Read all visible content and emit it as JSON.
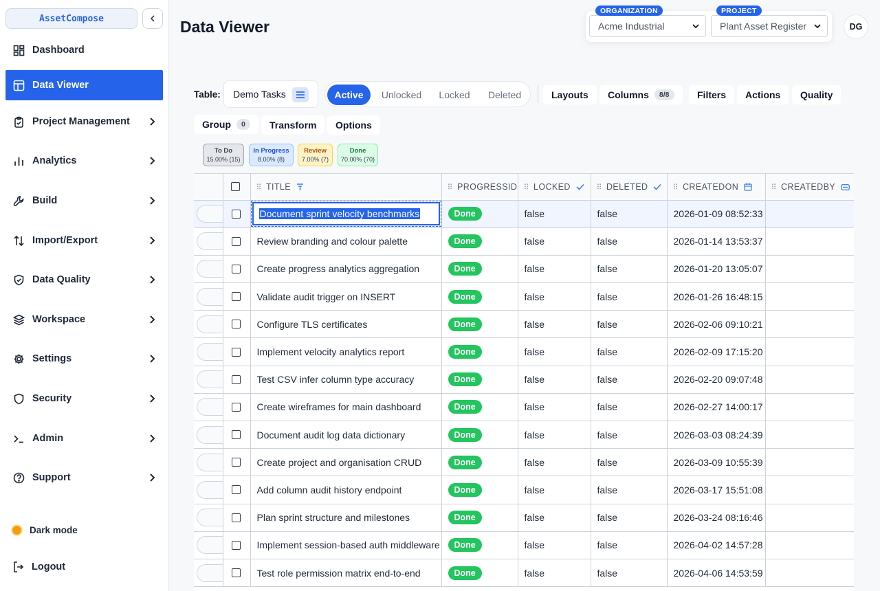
{
  "sidebar": {
    "brand": "AssetCompose",
    "items": [
      {
        "label": "Dashboard",
        "icon": "dashboard-icon"
      },
      {
        "label": "Data Viewer",
        "icon": "table-icon",
        "active": true
      },
      {
        "label": "Project Management",
        "icon": "clipboard-icon"
      },
      {
        "label": "Analytics",
        "icon": "bar-chart-icon"
      },
      {
        "label": "Build",
        "icon": "wrench-icon"
      },
      {
        "label": "Import/Export",
        "icon": "arrows-icon"
      },
      {
        "label": "Data Quality",
        "icon": "shield-check-icon"
      },
      {
        "label": "Workspace",
        "icon": "layers-icon"
      },
      {
        "label": "Settings",
        "icon": "gear-icon"
      },
      {
        "label": "Security",
        "icon": "shield-icon"
      },
      {
        "label": "Admin",
        "icon": "terminal-icon"
      },
      {
        "label": "Support",
        "icon": "help-icon"
      }
    ],
    "dark_mode": "Dark mode",
    "logout": "Logout"
  },
  "header": {
    "title": "Data Viewer",
    "org_label": "ORGANIZATION",
    "org_value": "Acme Industrial",
    "project_label": "PROJECT",
    "project_value": "Plant Asset Register",
    "avatar": "DG"
  },
  "toolbar": {
    "table_label": "Table:",
    "table_value": "Demo Tasks",
    "segments": [
      "Active",
      "Unlocked",
      "Locked",
      "Deleted"
    ],
    "buttons": {
      "layouts": "Layouts",
      "columns": "Columns",
      "columns_count": "8/8",
      "filters": "Filters",
      "actions": "Actions",
      "quality": "Quality",
      "group": "Group",
      "group_count": "0",
      "transform": "Transform",
      "options": "Options"
    }
  },
  "status_chips": [
    {
      "label": "To Do",
      "stat": "15.00% (15)",
      "bg": "#e5e7eb",
      "border": "#9ca3af",
      "color": "#374151"
    },
    {
      "label": "In Progress",
      "stat": "8.00% (8)",
      "bg": "#dbeafe",
      "border": "#93c5fd",
      "color": "#1d4ed8"
    },
    {
      "label": "Review",
      "stat": "7.00% (7)",
      "bg": "#fef3c7",
      "border": "#fcd34d",
      "color": "#b45309"
    },
    {
      "label": "Done",
      "stat": "70.00% (70)",
      "bg": "#dcfce7",
      "border": "#86efac",
      "color": "#15803d"
    }
  ],
  "table": {
    "columns": [
      "TITLE",
      "PROGRESSID",
      "LOCKED",
      "DELETED",
      "CREATEDON",
      "CREATEDBY"
    ],
    "rows": [
      {
        "title": "Document sprint velocity benchmarks",
        "progress": "Done",
        "locked": "false",
        "deleted": "false",
        "created_on": "2026-01-09 08:52:33",
        "created_by": ""
      },
      {
        "title": "Review branding and colour palette",
        "progress": "Done",
        "locked": "false",
        "deleted": "false",
        "created_on": "2026-01-14 13:53:37",
        "created_by": ""
      },
      {
        "title": "Create progress analytics aggregation",
        "progress": "Done",
        "locked": "false",
        "deleted": "false",
        "created_on": "2026-01-20 13:05:07",
        "created_by": ""
      },
      {
        "title": "Validate audit trigger on INSERT",
        "progress": "Done",
        "locked": "false",
        "deleted": "false",
        "created_on": "2026-01-26 16:48:15",
        "created_by": ""
      },
      {
        "title": "Configure TLS certificates",
        "progress": "Done",
        "locked": "false",
        "deleted": "false",
        "created_on": "2026-02-06 09:10:21",
        "created_by": ""
      },
      {
        "title": "Implement velocity analytics report",
        "progress": "Done",
        "locked": "false",
        "deleted": "false",
        "created_on": "2026-02-09 17:15:20",
        "created_by": ""
      },
      {
        "title": "Test CSV infer column type accuracy",
        "progress": "Done",
        "locked": "false",
        "deleted": "false",
        "created_on": "2026-02-20 09:07:48",
        "created_by": ""
      },
      {
        "title": "Create wireframes for main dashboard",
        "progress": "Done",
        "locked": "false",
        "deleted": "false",
        "created_on": "2026-02-27 14:00:17",
        "created_by": ""
      },
      {
        "title": "Document audit log data dictionary",
        "progress": "Done",
        "locked": "false",
        "deleted": "false",
        "created_on": "2026-03-03 08:24:39",
        "created_by": ""
      },
      {
        "title": "Create project and organisation CRUD",
        "progress": "Done",
        "locked": "false",
        "deleted": "false",
        "created_on": "2026-03-09 10:55:39",
        "created_by": ""
      },
      {
        "title": "Add column audit history endpoint",
        "progress": "Done",
        "locked": "false",
        "deleted": "false",
        "created_on": "2026-03-17 15:51:08",
        "created_by": ""
      },
      {
        "title": "Plan sprint structure and milestones",
        "progress": "Done",
        "locked": "false",
        "deleted": "false",
        "created_on": "2026-03-24 08:16:46",
        "created_by": ""
      },
      {
        "title": "Implement session-based auth middleware",
        "progress": "Done",
        "locked": "false",
        "deleted": "false",
        "created_on": "2026-04-02 14:57:28",
        "created_by": ""
      },
      {
        "title": "Test role permission matrix end-to-end",
        "progress": "Done",
        "locked": "false",
        "deleted": "false",
        "created_on": "2026-04-06 14:53:59",
        "created_by": ""
      }
    ]
  },
  "colors": {
    "accent": "#2563eb",
    "done": "#22c55e"
  }
}
